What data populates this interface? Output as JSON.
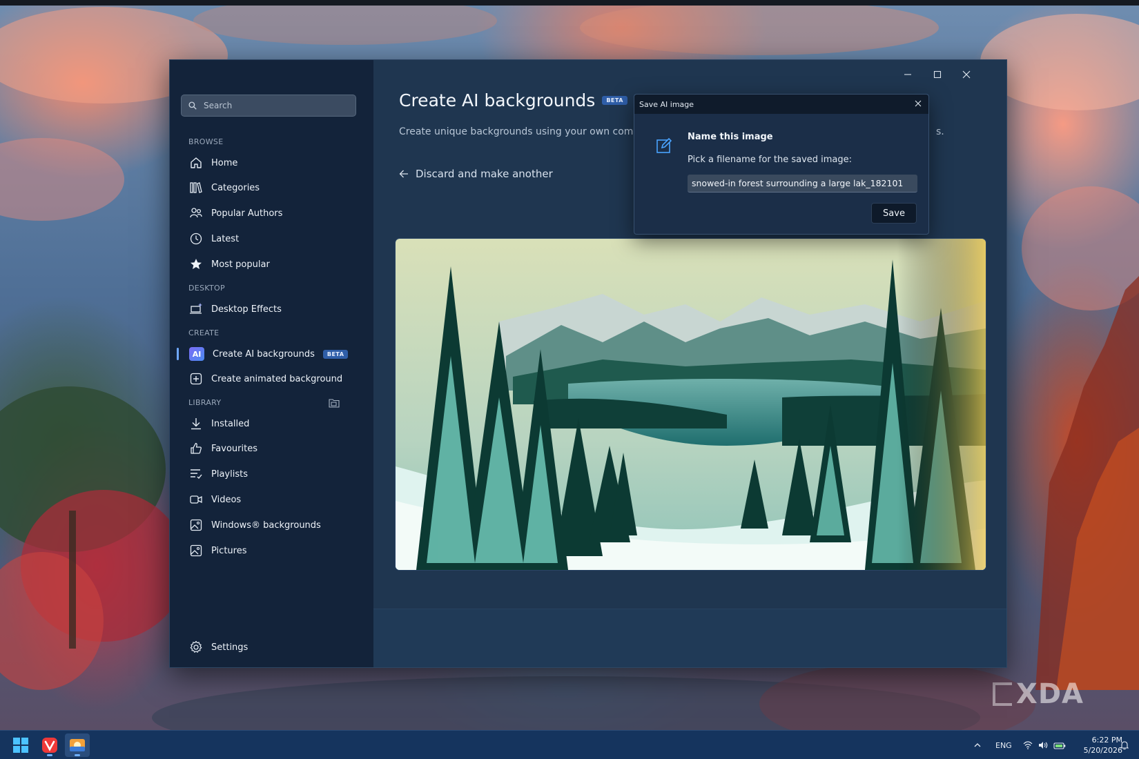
{
  "window": {
    "controls": {
      "minimize": "minimize",
      "maximize": "maximize",
      "close": "close"
    }
  },
  "sidebar": {
    "search_placeholder": "Search",
    "sections": {
      "browse": "BROWSE",
      "desktop": "DESKTOP",
      "create": "CREATE",
      "library": "LIBRARY"
    },
    "items": {
      "home": "Home",
      "categories": "Categories",
      "popular_authors": "Popular Authors",
      "latest": "Latest",
      "most_popular": "Most popular",
      "desktop_effects": "Desktop Effects",
      "create_ai": "Create AI backgrounds",
      "create_ai_badge": "BETA",
      "create_ai_icon_text": "AI",
      "create_animated": "Create animated background",
      "installed": "Installed",
      "favourites": "Favourites",
      "playlists": "Playlists",
      "videos": "Videos",
      "windows_backgrounds": "Windows® backgrounds",
      "pictures": "Pictures",
      "settings": "Settings"
    }
  },
  "main": {
    "title": "Create AI backgrounds",
    "title_badge": "BETA",
    "subtitle_start": "Create unique backgrounds using your own compu",
    "subtitle_end": "s.",
    "discard_label": "Discard and make another"
  },
  "dialog": {
    "title": "Save AI image",
    "heading": "Name this image",
    "prompt": "Pick a filename for the saved image:",
    "filename_value": "snowed-in forest surrounding a large lak_182101",
    "save_label": "Save"
  },
  "taskbar": {
    "language": "ENG",
    "time": "6:22 PM",
    "date": "5/20/2026"
  },
  "watermark": {
    "text": "XDA"
  },
  "colors": {
    "accent": "#6fa8ff",
    "sidebar_bg": "#13233a",
    "main_bg": "#1f3650",
    "beta_badge": "#2f5ea8"
  },
  "icons": {
    "search": "search-icon",
    "home": "home-icon",
    "categories": "categories-icon",
    "popular_authors": "people-icon",
    "latest": "clock-icon",
    "most_popular": "star-icon",
    "desktop_effects": "laptop-sparkle-icon",
    "create_animated": "add-square-icon",
    "installed": "download-icon",
    "favourites": "thumbs-up-icon",
    "playlists": "playlist-icon",
    "videos": "video-icon",
    "windows_backgrounds": "image-icon",
    "pictures": "image-icon",
    "settings": "gear-icon"
  }
}
